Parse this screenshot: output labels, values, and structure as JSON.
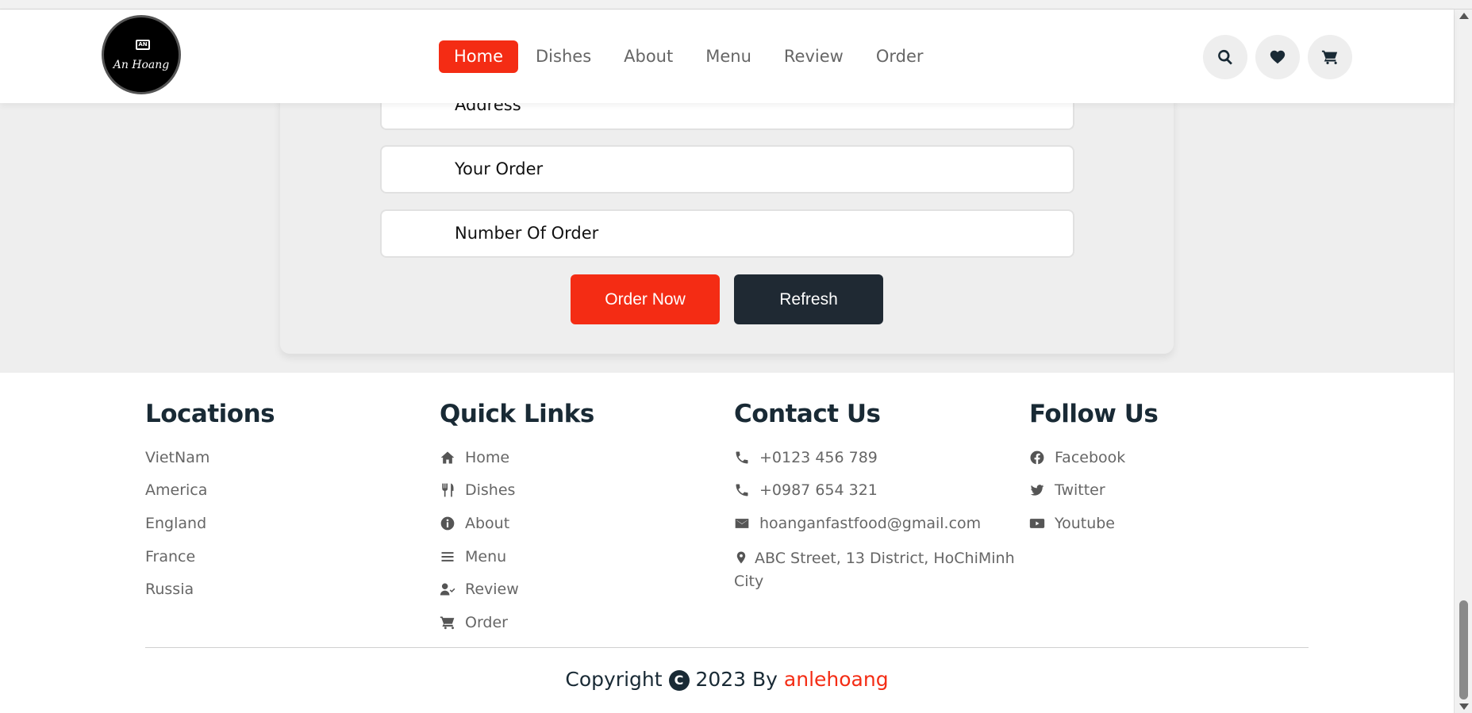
{
  "brand": {
    "logo_badge": "AN",
    "logo_text": "An Hoang"
  },
  "nav": {
    "items": [
      "Home",
      "Dishes",
      "About",
      "Menu",
      "Review",
      "Order"
    ],
    "active": "Home"
  },
  "header_icons": [
    "search-icon",
    "heart-icon",
    "cart-icon"
  ],
  "order_form": {
    "fields": [
      "Address",
      "Your Order",
      "Number Of Order"
    ],
    "order_button": "Order Now",
    "refresh_button": "Refresh"
  },
  "footer": {
    "locations": {
      "title": "Locations",
      "items": [
        "VietNam",
        "America",
        "England",
        "France",
        "Russia"
      ]
    },
    "quick_links": {
      "title": "Quick Links",
      "items": [
        "Home",
        "Dishes",
        "About",
        "Menu",
        "Review",
        "Order"
      ],
      "icons": [
        "home-icon",
        "utensils-icon",
        "info-icon",
        "menu-icon",
        "user-check-icon",
        "cart-icon"
      ]
    },
    "contact": {
      "title": "Contact Us",
      "phone1": "+0123 456 789",
      "phone2": "+0987 654 321",
      "email": "hoanganfastfood@gmail.com",
      "address": "ABC Street, 13 District, HoChiMinh City"
    },
    "follow": {
      "title": "Follow Us",
      "items": [
        "Facebook",
        "Twitter",
        "Youtube"
      ]
    },
    "copyright": {
      "prefix": "Copyright",
      "year_by": "2023 By",
      "author": "anlehoang"
    }
  },
  "colors": {
    "accent": "#f42c14",
    "dark": "#192a35",
    "light_bg": "#eeeeee"
  }
}
